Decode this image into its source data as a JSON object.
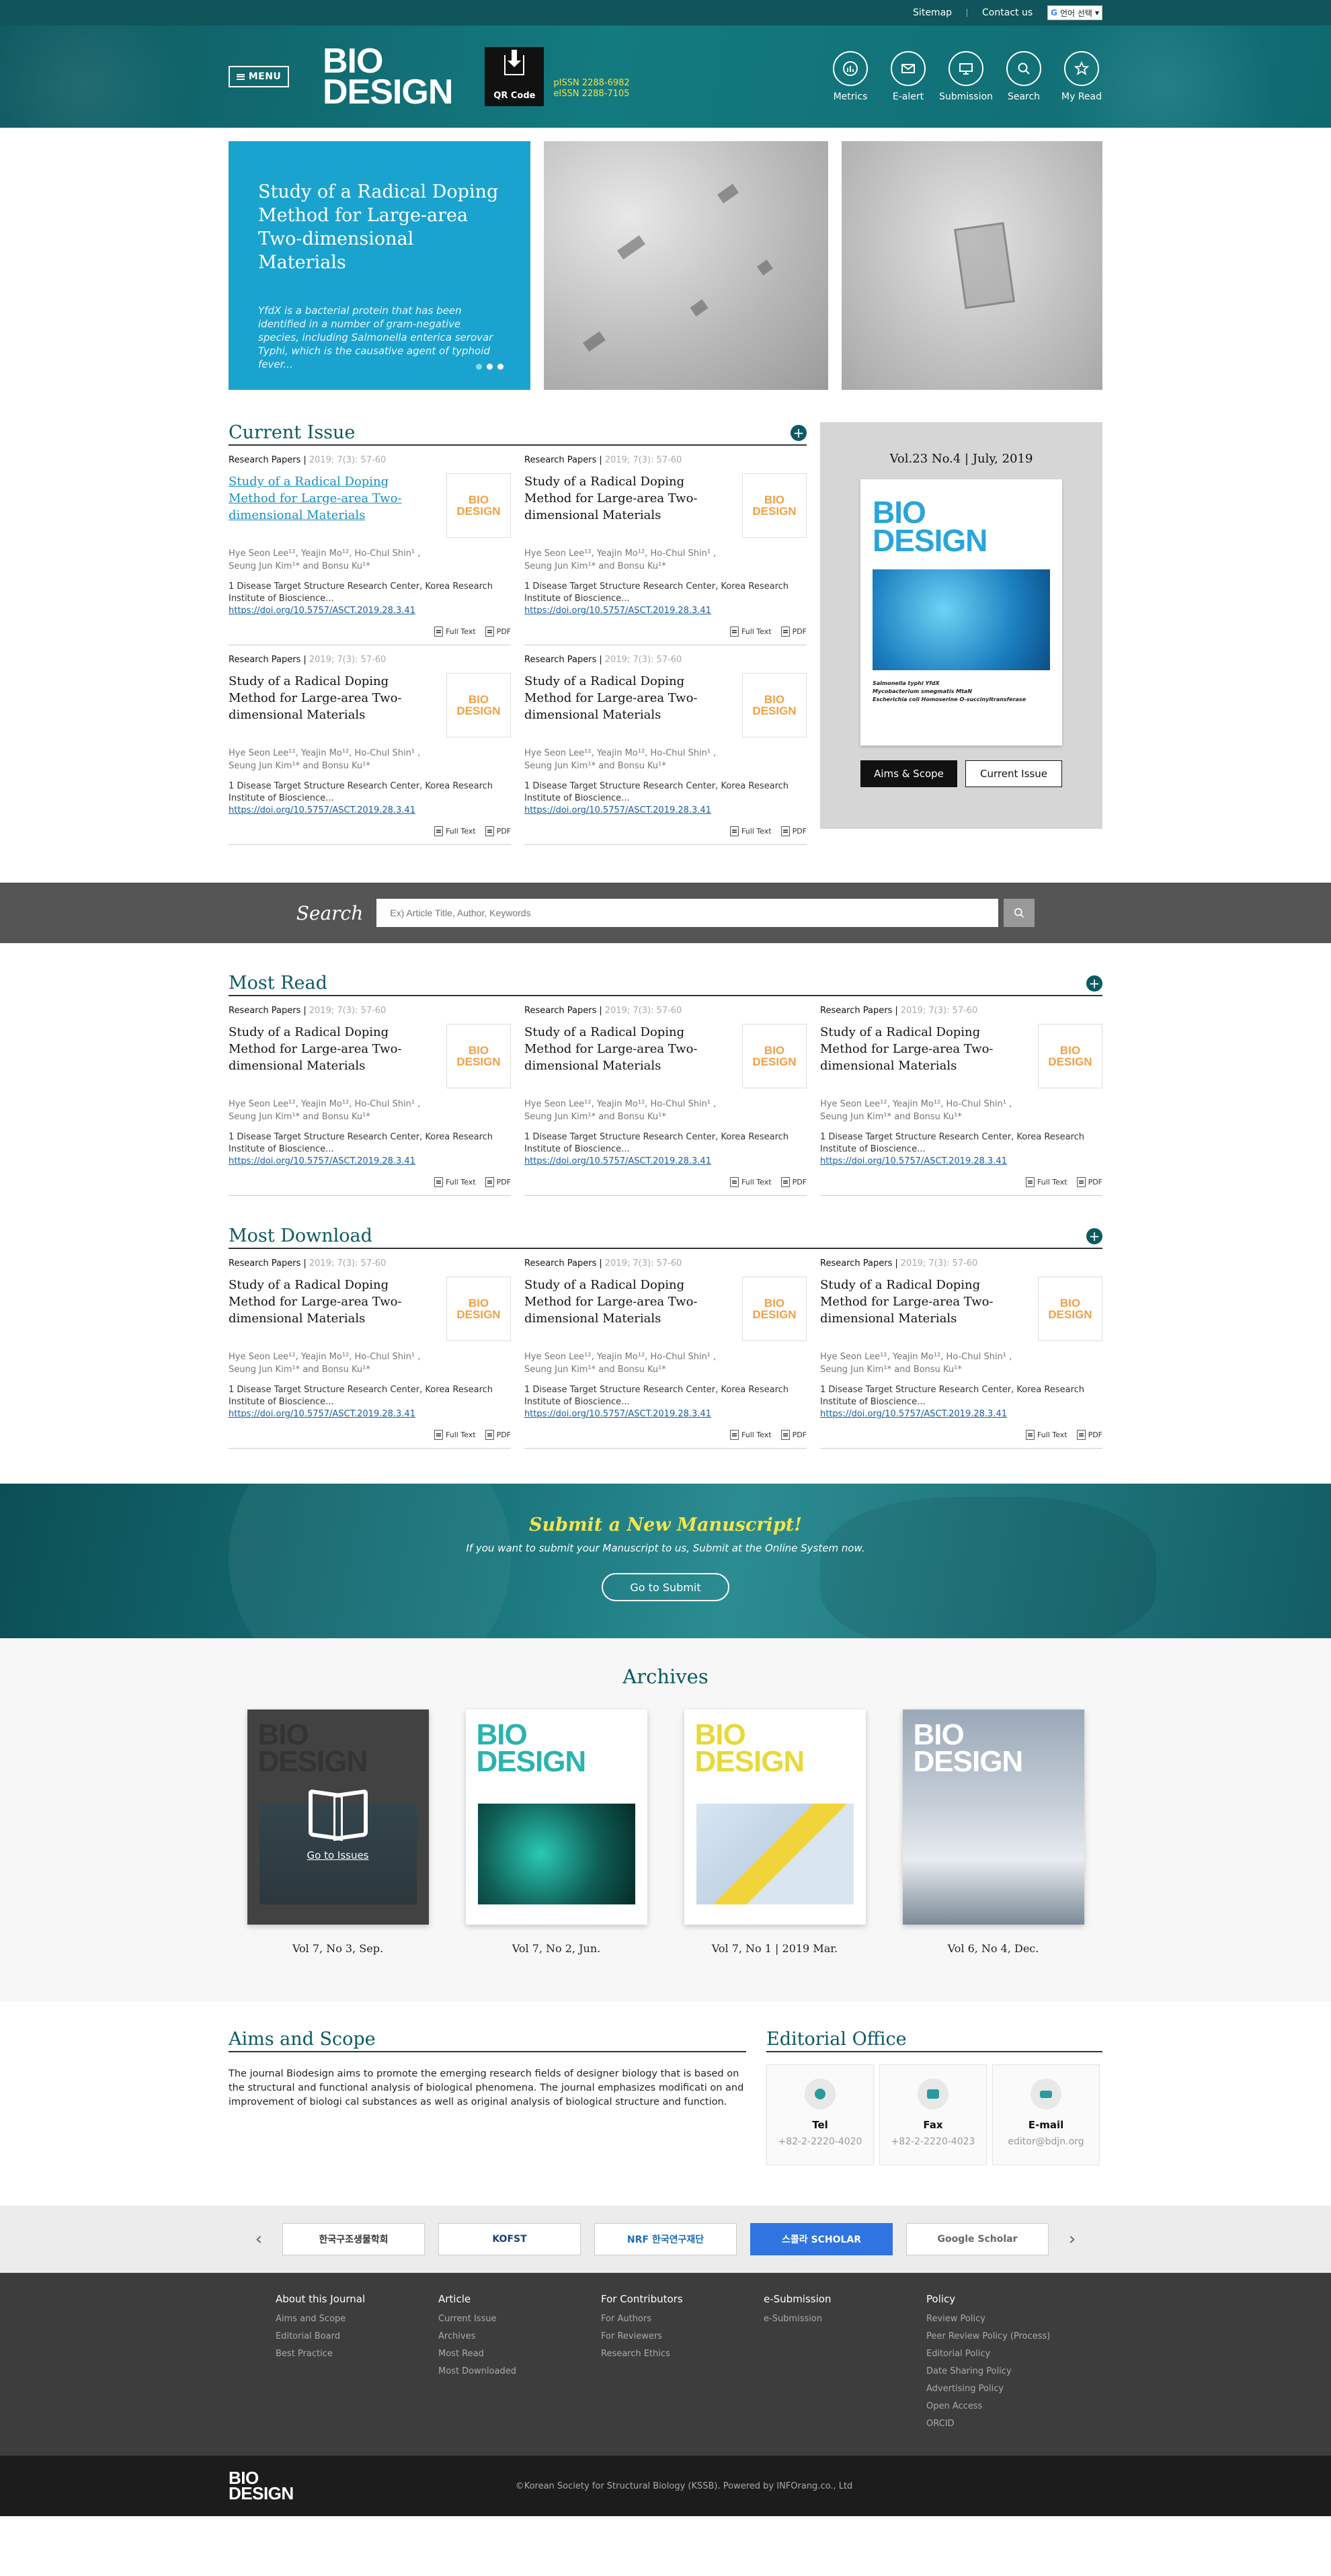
{
  "topbar": {
    "sitemap": "Sitemap",
    "contact": "Contact us",
    "language": "언어 선택"
  },
  "header": {
    "menu": "MENU",
    "logo_line1": "BIO",
    "logo_line2": "DESIGN",
    "qr_label": "QR Code",
    "pissn": "pISSN  2288-6982",
    "eissn": "eISSN  2288-7105",
    "icons": [
      {
        "label": "Metrics",
        "icon": "metrics-icon"
      },
      {
        "label": "E-alert",
        "icon": "mail-icon"
      },
      {
        "label": "Submission",
        "icon": "monitor-icon"
      },
      {
        "label": "Search",
        "icon": "search-icon"
      },
      {
        "label": "My Read",
        "icon": "star-icon"
      }
    ]
  },
  "hero": {
    "title": "Study of a Radical Doping Method for Large-area Two-dimensional Materials",
    "text": "YfdX is a bacterial protein that has been identified in a number of gram-negative species, including Salmonella enterica serovar Typhi, which is the causative agent of typhoid fever..."
  },
  "current_issue": {
    "title": "Current Issue",
    "cover_volume": "Vol.23 No.4   |   July, 2019",
    "cover_caption": "Salmonella typhi YfdX\nMycobacterium smegmatis MtaN\nEscherichia coli Homoserine O-succinyltransferase",
    "btn_aims": "Aims & Scope",
    "btn_current": "Current Issue"
  },
  "article": {
    "type": "Research Papers",
    "meta": "2019; 7(3): 57-60",
    "title": "Study of a Radical Doping Method for Large-area Two-dimensional Materials",
    "authors_line1": "Hye Seon Lee¹², Yeajin Mo¹², Ho-Chul Shin¹ ,",
    "authors_line2": "Seung Jun Kim¹* and Bonsu Ku¹*",
    "affiliation": "1 Disease Target Structure Research Center, Korea Research Institute of Bioscience...",
    "doi": "https://doi.org/10.5757/ASCT.2019.28.3.41",
    "full_text": "Full Text",
    "pdf": "PDF",
    "thumb_line1": "BIO",
    "thumb_line2": "DESIGN"
  },
  "search": {
    "label": "Search",
    "placeholder": "Ex) Article Title, Author, Keywords"
  },
  "most_read": {
    "title": "Most Read"
  },
  "most_download": {
    "title": "Most Download"
  },
  "submit": {
    "title": "Submit a New Manuscript!",
    "text": "If you want to submit your Manuscript to us, Submit at the Online System now.",
    "button": "Go to Submit"
  },
  "archives": {
    "title": "Archives",
    "go_to_issues": "Go to Issues",
    "items": [
      {
        "label": "Vol 7, No 3, Sep."
      },
      {
        "label": "Vol 7, No 2, Jun."
      },
      {
        "label": "Vol 7, No 1  |  2019 Mar."
      },
      {
        "label": "Vol 6, No 4, Dec."
      }
    ]
  },
  "aims": {
    "title": "Aims and Scope",
    "text": "The journal Biodesign aims to promote the emerging research fields of designer biology that is based on the structural and functional analysis of biological phenomena. The journal emphasizes modificati on and improvement of biologi cal substances as well as original analysis of biological structure and function."
  },
  "editorial": {
    "title": "Editorial Office",
    "contacts": [
      {
        "name": "Tel",
        "value": "+82-2-2220-4020"
      },
      {
        "name": "Fax",
        "value": "+82-2-2220-4023"
      },
      {
        "name": "E-mail",
        "value": "editor@bdjn.org"
      }
    ]
  },
  "partners": [
    "한국구조생물학회",
    "KOFST",
    "NRF 한국연구재단",
    "스콜라 SCHOLAR",
    "Google Scholar"
  ],
  "footer": {
    "cols": [
      {
        "title": "About this Journal",
        "links": [
          "Aims and Scope",
          "Editorial Board",
          "Best Practice"
        ]
      },
      {
        "title": "Article",
        "links": [
          "Current Issue",
          "Archives",
          "Most Read",
          "Most Downloaded"
        ]
      },
      {
        "title": "For Contributors",
        "links": [
          "For Authors",
          "For Reviewers",
          "Research Ethics"
        ]
      },
      {
        "title": "e-Submission",
        "links": [
          "e-Submission"
        ]
      },
      {
        "title": "Policy",
        "links": [
          "Review Policy",
          "Peer Review Policy (Process)",
          "Editorial Policy",
          "Date Sharing Policy",
          "Advertising Policy",
          "Open Access",
          "ORCID"
        ]
      }
    ],
    "logo_line1": "BIO",
    "logo_line2": "DESIGN",
    "copyright": "©Korean Society for Structural Biology (KSSB). Powered by INFOrang.co., Ltd"
  },
  "colors": {
    "primary": "#0b5a61",
    "accent_blue": "#1ba3cf",
    "accent_yellow": "#f4e44c",
    "thumb_orange": "#f3a046"
  }
}
